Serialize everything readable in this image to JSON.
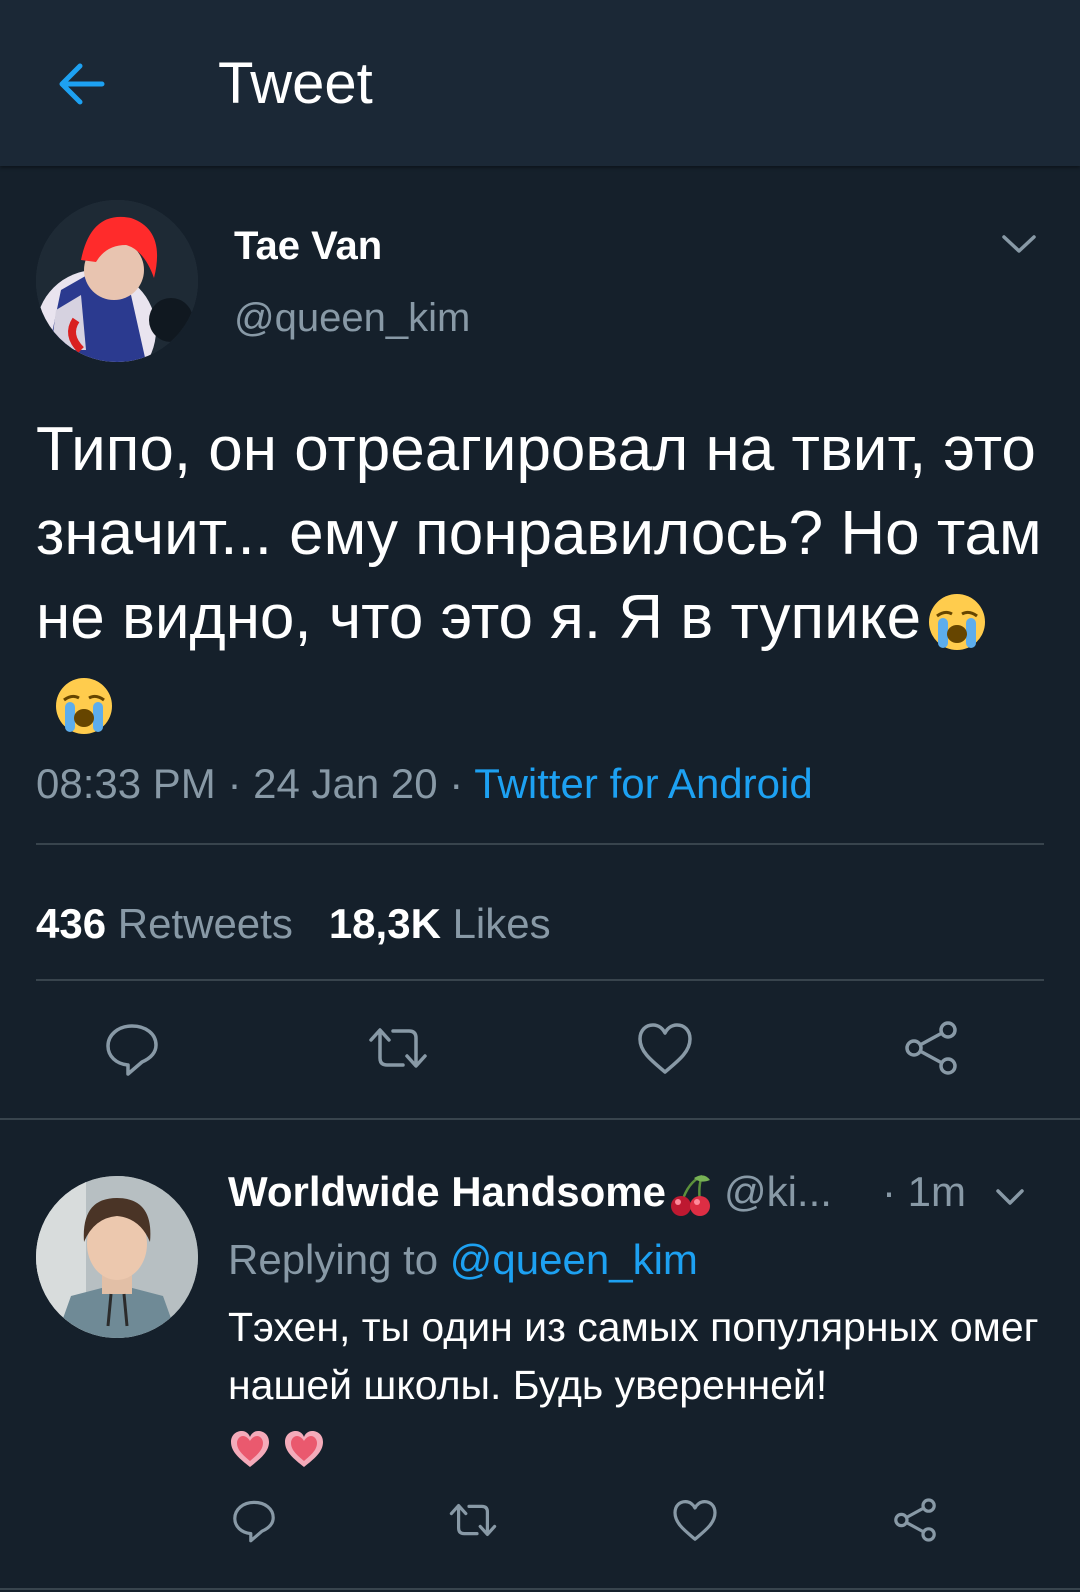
{
  "header": {
    "title": "Tweet",
    "back_icon": "arrow-left-icon"
  },
  "tweet": {
    "author_name": "Tae Van",
    "author_handle": "@queen_kim",
    "text": "Типо, он отреагировал на твит, это значит... ему понравилось? Но там не видно, что это я. Я в тупике",
    "emojis": [
      "loudly-crying-face",
      "loudly-crying-face"
    ],
    "time": "08:33 PM",
    "separator": "·",
    "date": "24 Jan 20",
    "source": "Twitter for Android",
    "retweets_count": "436",
    "retweets_label": "Retweets",
    "likes_count": "18,3K",
    "likes_label": "Likes"
  },
  "reply": {
    "author_name": "Worldwide Handsome",
    "name_emoji": "cherries",
    "author_handle": "@ki...",
    "time": "· 1m",
    "replying_label": "Replying to",
    "replying_mention": "@queen_kim",
    "text": "Тэхен, ты один из самых популярных омег нашей школы. Будь уверенней!",
    "emojis": [
      "pink-heart",
      "pink-heart"
    ]
  },
  "colors": {
    "background": "#15202b",
    "header": "#1b2836",
    "accent": "#1da1f2",
    "secondary_text": "#8899a6",
    "divider": "#38444d"
  }
}
